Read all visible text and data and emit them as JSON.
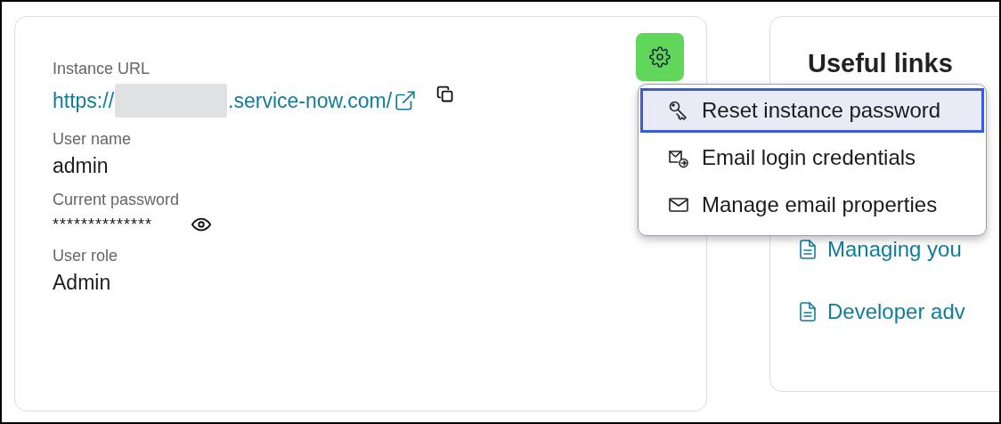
{
  "details": [
    {
      "kind": "url",
      "label": "Instance URL",
      "prefix": "https://",
      "redacted": true,
      "suffix": ".service-now.com/"
    },
    {
      "kind": "text",
      "label": "User name",
      "value": "admin"
    },
    {
      "kind": "secret",
      "label": "Current password",
      "value": "**************"
    },
    {
      "kind": "text",
      "label": "User role",
      "value": "Admin"
    }
  ],
  "menu": {
    "expanded": true,
    "items": [
      {
        "label": "Reset instance password",
        "kind": "key",
        "selected": true
      },
      {
        "label": "Email login credentials",
        "kind": "mail-send",
        "selected": false
      },
      {
        "label": "Manage email properties",
        "kind": "mail",
        "selected": false
      }
    ]
  },
  "useful_links": {
    "title": "Useful links",
    "links": [
      {
        "label": "Managing you"
      },
      {
        "label": "Developer adv"
      }
    ]
  }
}
